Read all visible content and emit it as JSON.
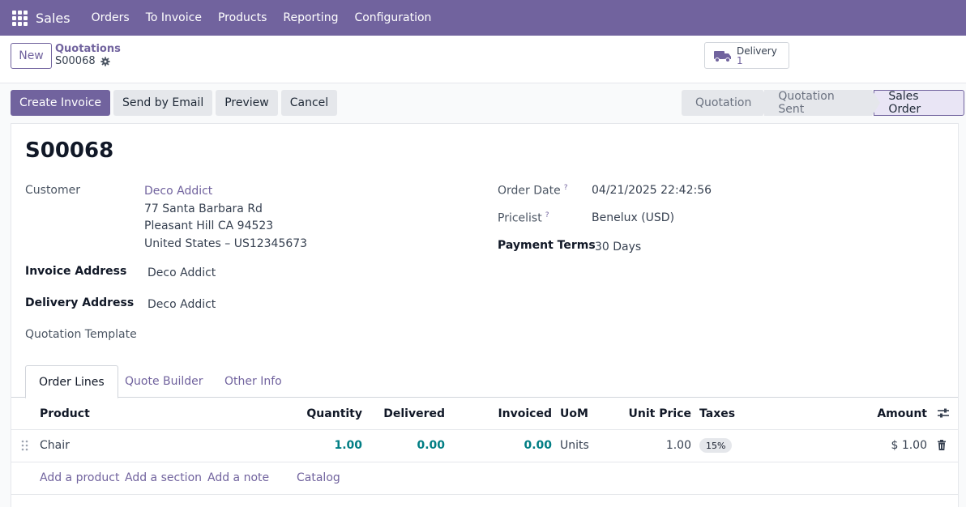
{
  "navbar": {
    "app": "Sales",
    "menu": [
      "Orders",
      "To Invoice",
      "Products",
      "Reporting",
      "Configuration"
    ]
  },
  "control": {
    "new_label": "New",
    "breadcrumb": "Quotations",
    "record": "S00068",
    "smart_button": {
      "label": "Delivery",
      "count": "1"
    }
  },
  "actions": [
    "Create Invoice",
    "Send by Email",
    "Preview",
    "Cancel"
  ],
  "statusbar": {
    "stages": [
      "Quotation",
      "Quotation Sent",
      "Sales Order"
    ],
    "active": "Sales Order"
  },
  "form": {
    "title": "S00068",
    "customer_label": "Customer",
    "customer_name": "Deco Addict",
    "customer_address": [
      "77 Santa Barbara Rd",
      "Pleasant Hill CA 94523",
      "United States – US12345673"
    ],
    "invoice_address_label": "Invoice Address",
    "invoice_address": "Deco Addict",
    "delivery_address_label": "Delivery Address",
    "delivery_address": "Deco Addict",
    "quotation_template_label": "Quotation Template",
    "order_date_label": "Order Date",
    "order_date": "04/21/2025 22:42:56",
    "pricelist_label": "Pricelist",
    "pricelist": "Benelux (USD)",
    "payment_terms_label": "Payment Terms",
    "payment_terms": "30 Days",
    "help_mark": "?"
  },
  "tabs": [
    "Order Lines",
    "Quote Builder",
    "Other Info"
  ],
  "table": {
    "headers": {
      "product": "Product",
      "quantity": "Quantity",
      "delivered": "Delivered",
      "invoiced": "Invoiced",
      "uom": "UoM",
      "unit_price": "Unit Price",
      "taxes": "Taxes",
      "amount": "Amount"
    },
    "rows": [
      {
        "product": "Chair",
        "quantity": "1.00",
        "delivered": "0.00",
        "invoiced": "0.00",
        "uom": "Units",
        "unit_price": "1.00",
        "taxes": "15%",
        "amount": "$ 1.00"
      }
    ],
    "add_links": [
      "Add a product",
      "Add a section",
      "Add a note",
      "Catalog"
    ]
  },
  "colors": {
    "brand": "#71639e",
    "link_teal": "#017e84"
  }
}
